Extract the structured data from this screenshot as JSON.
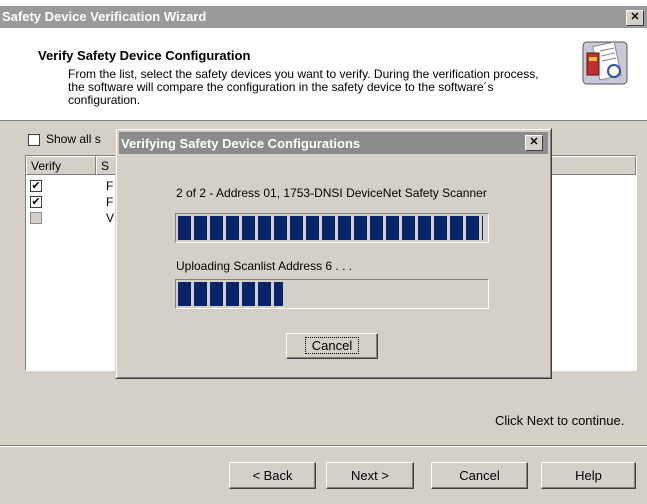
{
  "window": {
    "title": "Safety Device Verification Wizard",
    "close_glyph": "✕"
  },
  "header": {
    "title": "Verify Safety Device Configuration",
    "description": "From the list, select the safety devices you want to verify. During the verification process, the software will compare the configuration in the safety device to the software´s configuration."
  },
  "show_all": {
    "label": "Show all s",
    "checked": false
  },
  "list": {
    "columns": [
      "Verify",
      "S"
    ],
    "rows": [
      {
        "checked": true,
        "text": "F"
      },
      {
        "checked": true,
        "text": "F"
      },
      {
        "checked": false,
        "text": "V"
      }
    ]
  },
  "status_text": "Click Next to continue.",
  "buttons": {
    "back": "< Back",
    "next": "Next >",
    "cancel": "Cancel",
    "help": "Help"
  },
  "dialog": {
    "title": "Verifying Safety Device Configurations",
    "close_glyph": "✕",
    "device_line": "2 of 2 - Address 01, 1753-DNSI DeviceNet Safety Scanner",
    "progress_main": 0.99,
    "upload_line": "Uploading Scanlist Address 6 . . .",
    "progress_upload": 0.34,
    "cancel_label": "Cancel"
  },
  "colors": {
    "title_bar": "#9a9a9a",
    "progress_blue": "#0a246a",
    "face": "#d4d0c8"
  }
}
